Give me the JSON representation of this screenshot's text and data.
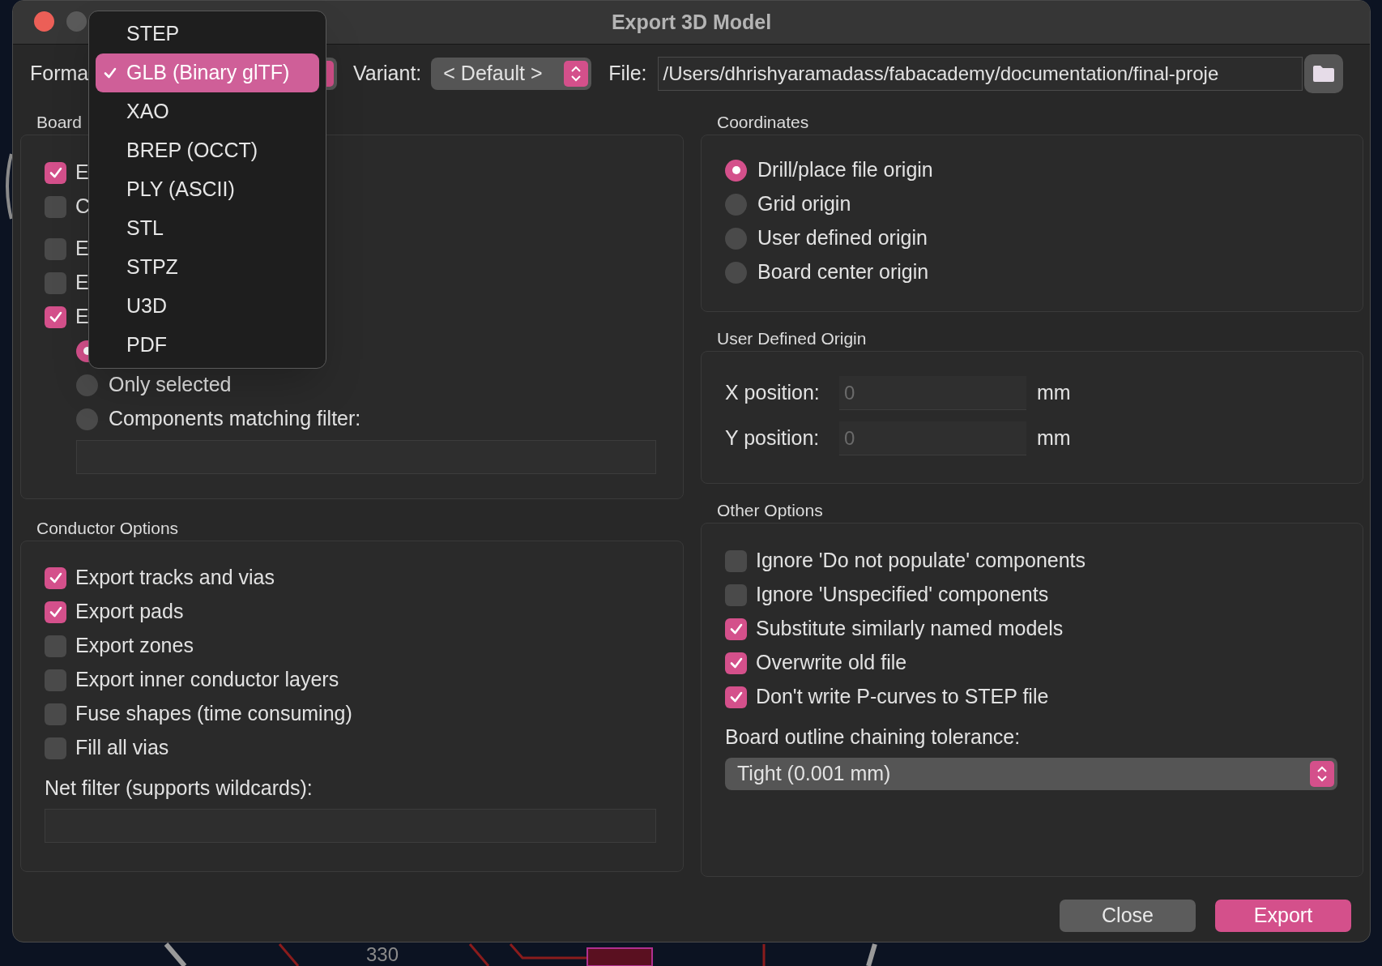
{
  "window": {
    "title": "Export 3D Model"
  },
  "format": {
    "label": "Forma",
    "options": [
      {
        "label": "STEP",
        "selected": false
      },
      {
        "label": "GLB (Binary glTF)",
        "selected": true
      },
      {
        "label": "XAO",
        "selected": false
      },
      {
        "label": "BREP (OCCT)",
        "selected": false
      },
      {
        "label": "PLY (ASCII)",
        "selected": false
      },
      {
        "label": "STL",
        "selected": false
      },
      {
        "label": "STPZ",
        "selected": false
      },
      {
        "label": "U3D",
        "selected": false
      },
      {
        "label": "PDF",
        "selected": false
      }
    ]
  },
  "variant": {
    "label": "Variant:",
    "value": "< Default >"
  },
  "file": {
    "label": "File:",
    "value": "/Users/dhrishyaramadass/fabacademy/documentation/final-proje"
  },
  "board": {
    "heading": "Board",
    "option_groups": [
      [
        {
          "label": "E",
          "checked": true
        },
        {
          "label": "C",
          "checked": false
        }
      ],
      [
        {
          "label": "E",
          "checked": false
        },
        {
          "label": "E",
          "checked": false
        },
        {
          "label": "E",
          "checked": true
        }
      ]
    ],
    "scope": [
      {
        "selected": true
      },
      {
        "label": "Only selected",
        "selected": false
      },
      {
        "label": "Components matching filter:",
        "selected": false
      }
    ]
  },
  "conductor": {
    "heading": "Conductor Options",
    "options": [
      {
        "label": "Export tracks and vias",
        "checked": true
      },
      {
        "label": "Export pads",
        "checked": true
      },
      {
        "label": "Export zones",
        "checked": false
      },
      {
        "label": "Export inner conductor layers",
        "checked": false
      },
      {
        "label": "Fuse shapes (time consuming)",
        "checked": false
      },
      {
        "label": "Fill all vias",
        "checked": false
      }
    ],
    "net_filter_label": "Net filter (supports wildcards):"
  },
  "coordinates": {
    "heading": "Coordinates",
    "origins": [
      {
        "label": "Drill/place file origin",
        "selected": true
      },
      {
        "label": "Grid origin",
        "selected": false
      },
      {
        "label": "User defined origin",
        "selected": false
      },
      {
        "label": "Board center origin",
        "selected": false
      }
    ]
  },
  "user_origin": {
    "heading": "User Defined Origin",
    "fields": [
      {
        "label": "X position:",
        "value": "0",
        "unit": "mm",
        "disabled": true
      },
      {
        "label": "Y position:",
        "value": "0",
        "unit": "mm",
        "disabled": true
      }
    ]
  },
  "other": {
    "heading": "Other Options",
    "options": [
      {
        "label": "Ignore 'Do not populate' components",
        "checked": false
      },
      {
        "label": "Ignore 'Unspecified' components",
        "checked": false
      },
      {
        "label": "Substitute similarly named models",
        "checked": true
      },
      {
        "label": "Overwrite old file",
        "checked": true
      },
      {
        "label": "Don't write P-curves to STEP file",
        "checked": true
      }
    ],
    "tolerance_label": "Board outline chaining tolerance:",
    "tolerance": "Tight (0.001 mm)"
  },
  "buttons": [
    {
      "label": "Close",
      "kind": "secondary"
    },
    {
      "label": "Export",
      "kind": "primary"
    }
  ],
  "canvas": {
    "label": "330"
  }
}
